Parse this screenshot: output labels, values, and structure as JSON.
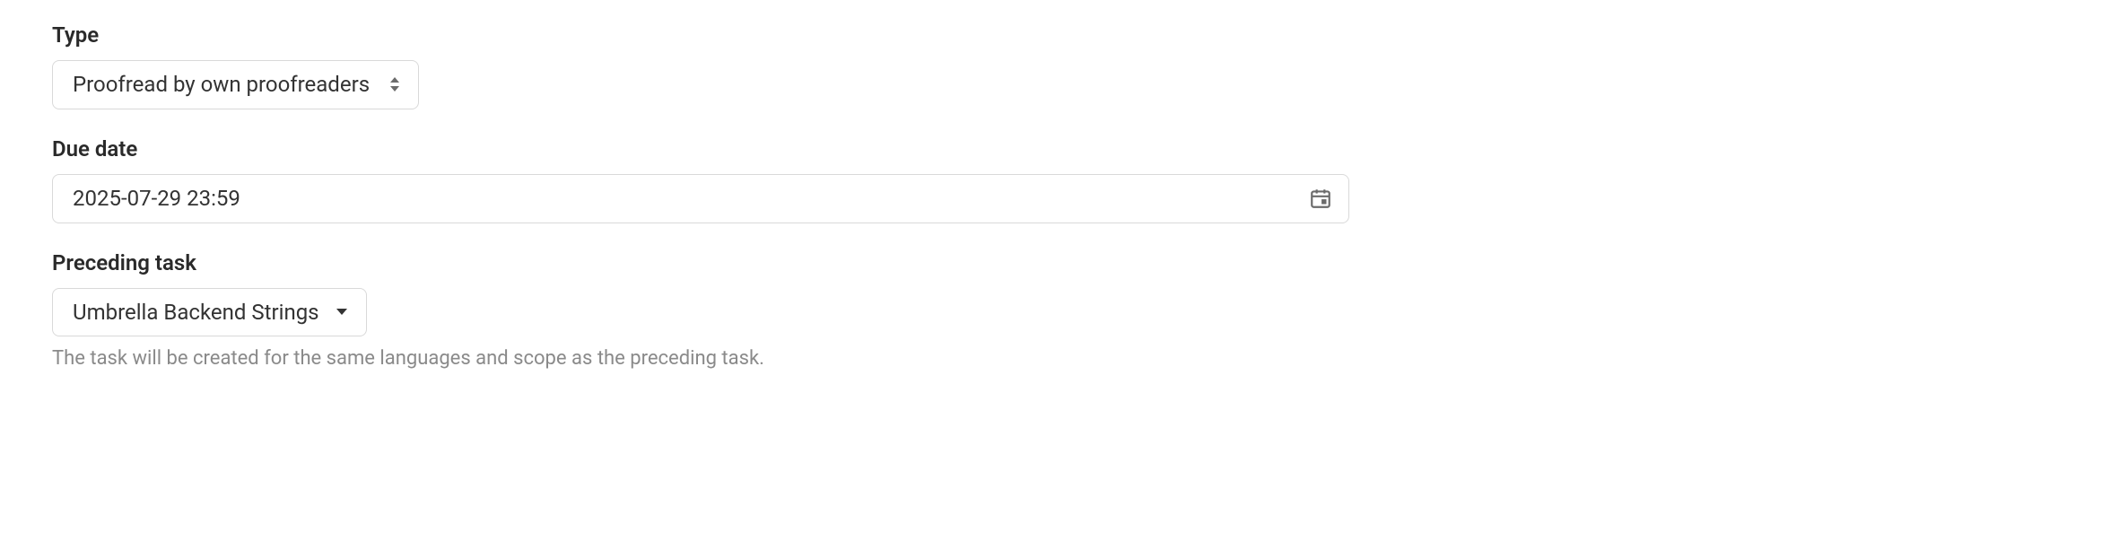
{
  "fields": {
    "type": {
      "label": "Type",
      "value": "Proofread by own proofreaders"
    },
    "due_date": {
      "label": "Due date",
      "value": "2025-07-29 23:59"
    },
    "preceding_task": {
      "label": "Preceding task",
      "value": "Umbrella Backend Strings",
      "helper": "The task will be created for the same languages and scope as the preceding task."
    }
  }
}
